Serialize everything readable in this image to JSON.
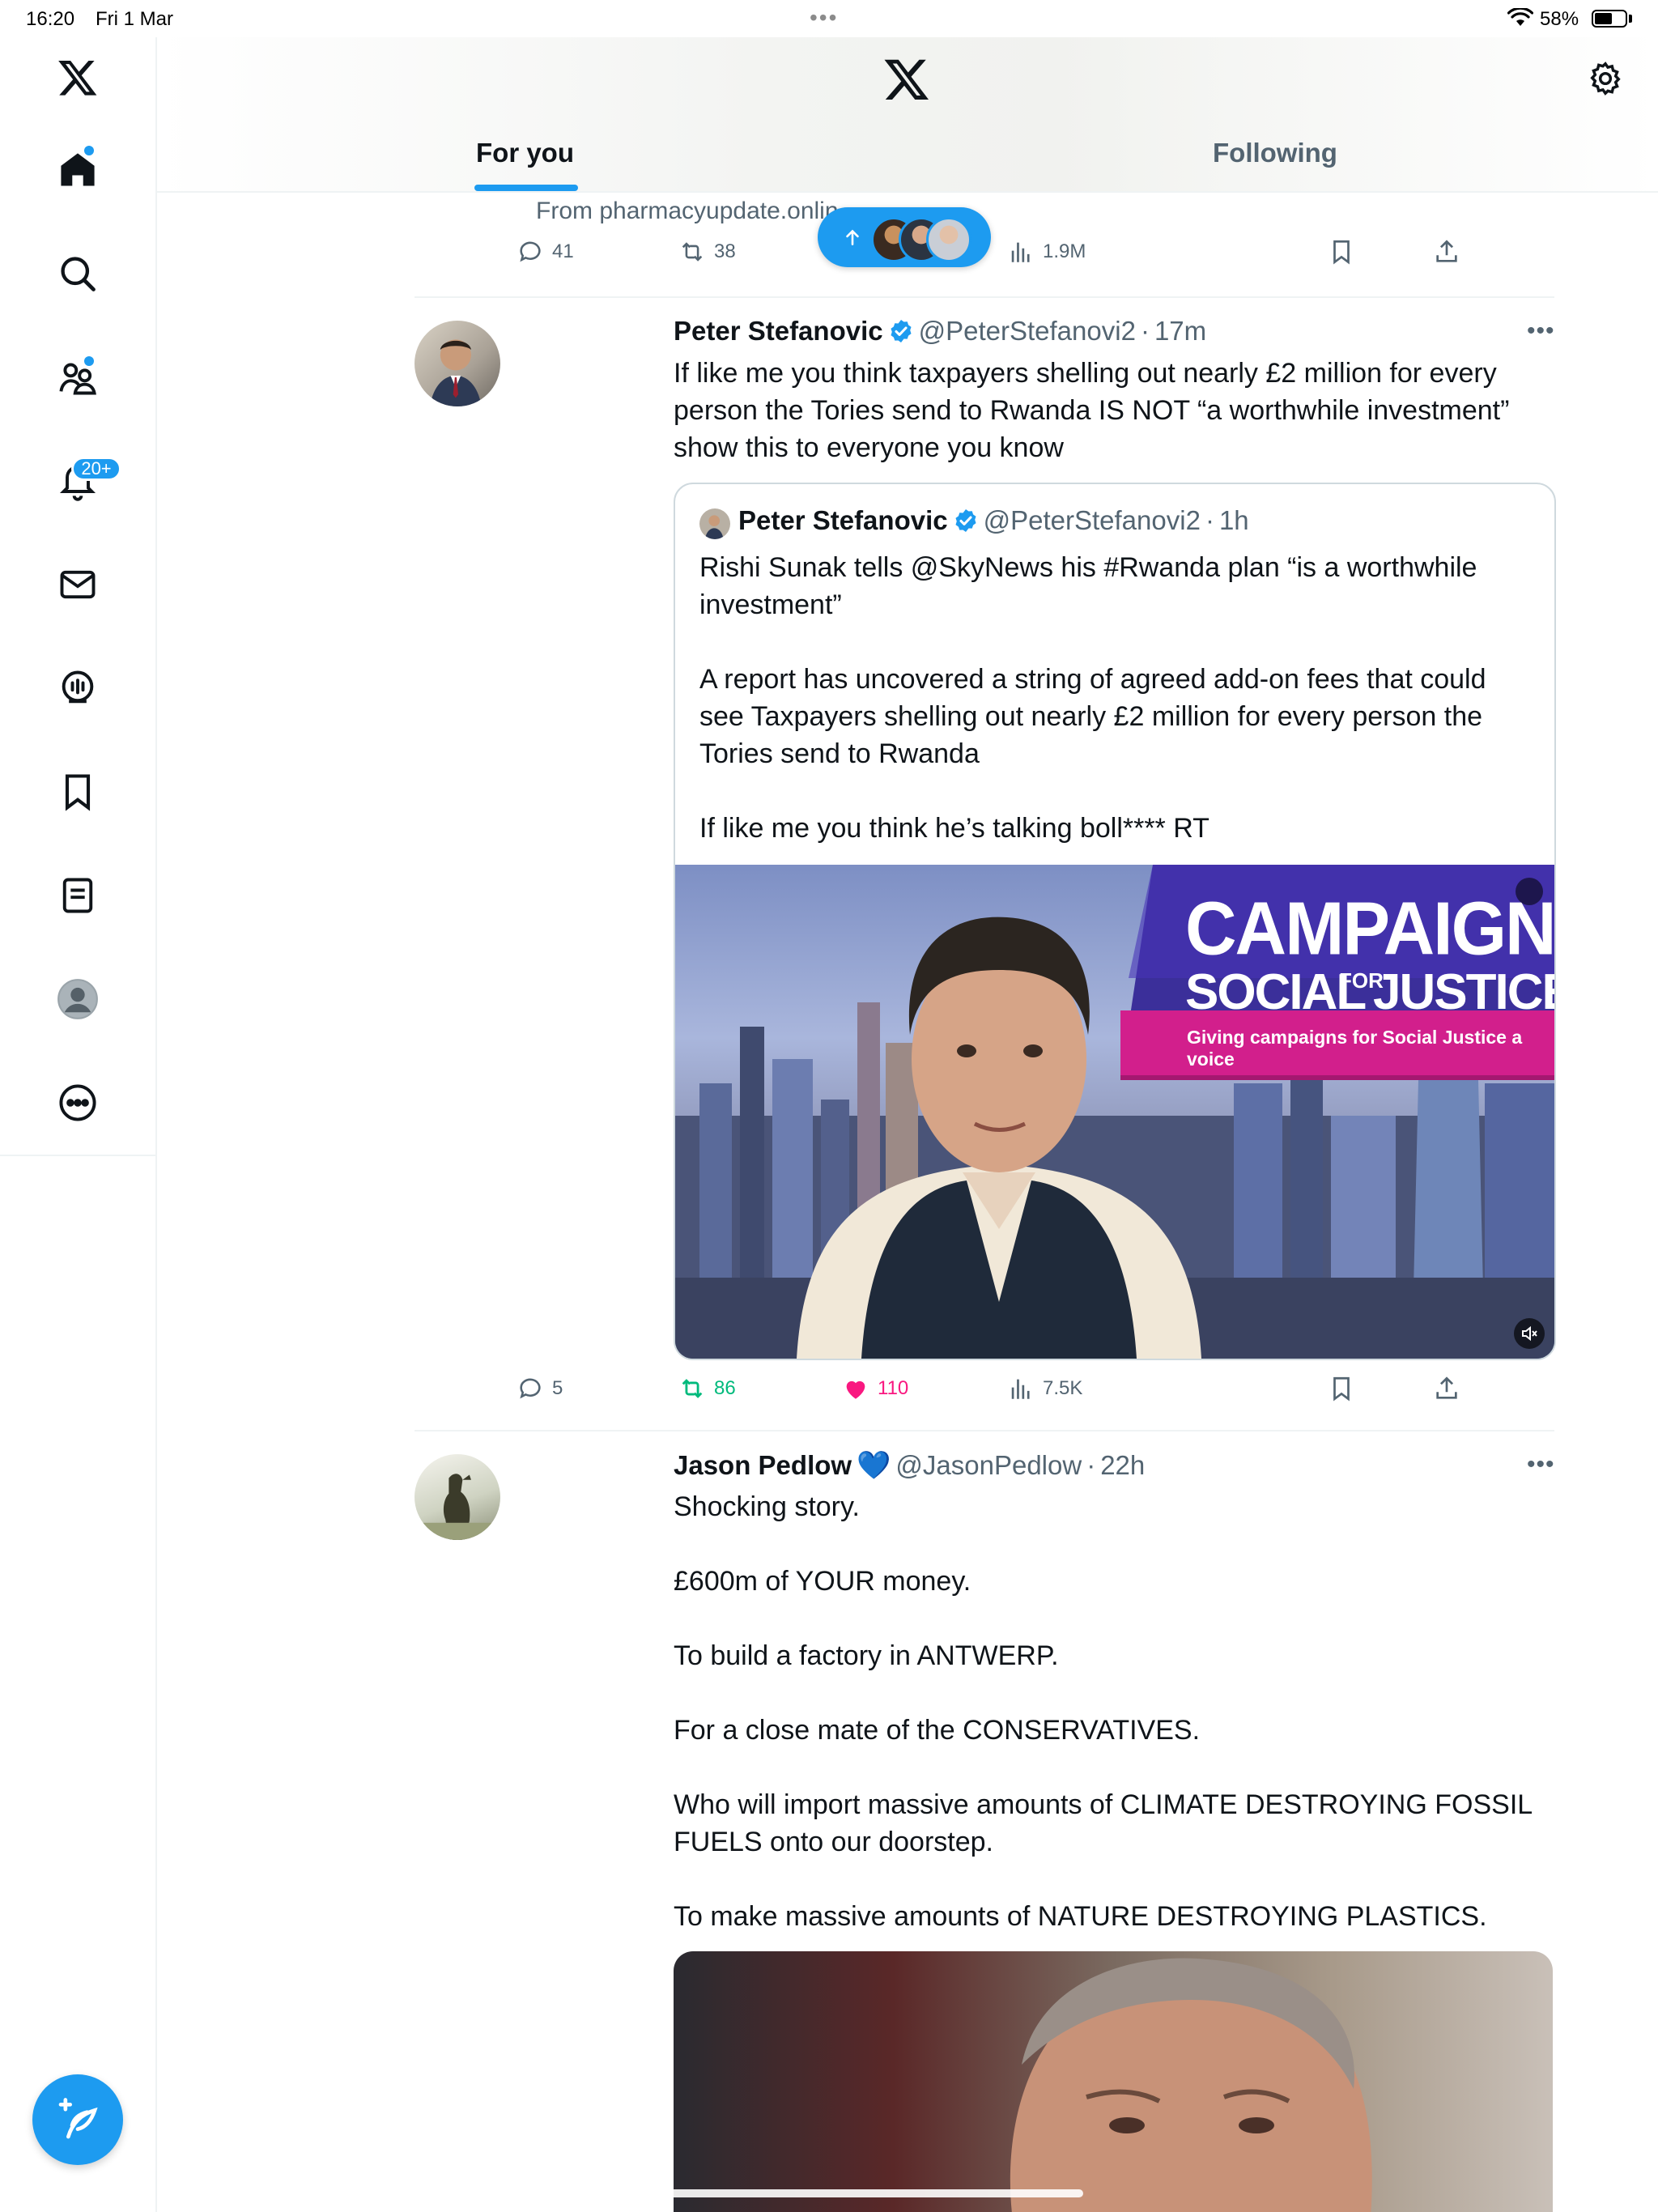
{
  "status_bar": {
    "time": "16:20",
    "date": "Fri 1 Mar",
    "battery_pct": "58%",
    "battery_level": 0.58
  },
  "nav": {
    "notifications_badge": "20+"
  },
  "tabs": {
    "for_you": "For you",
    "following": "Following"
  },
  "posts": [
    {
      "source_text": "From pharmacyupdate.onlin",
      "replies": "41",
      "reposts": "38",
      "views": "1.9M"
    },
    {
      "name": "Peter Stefanovic",
      "handle": "@PeterStefanovi2",
      "dot": "·",
      "time": "17m",
      "text": "If like me you think taxpayers shelling out nearly £2 million for every person the Tories send to Rwanda IS NOT “a worthwhile investment” show this to everyone you know",
      "quote": {
        "name": "Peter Stefanovic",
        "handle": "@PeterStefanovi2",
        "dot": "·",
        "time": "1h",
        "paragraphs": [
          "Rishi Sunak tells @SkyNews his #Rwanda plan “is a worthwhile investment”",
          "A report has uncovered a string of agreed add-on fees that could see Taxpayers shelling out nearly £2 million for every person the Tories send to Rwanda",
          "If like me you think he’s talking boll**** RT"
        ],
        "banner_line1": "CAMPAIGN",
        "banner_line2a": "SOCIAL",
        "banner_line2b": "FOR",
        "banner_line2c": "JUSTICE",
        "banner_tagline": "Giving campaigns for Social Justice a voice"
      },
      "replies": "5",
      "reposts": "86",
      "likes": "110",
      "views": "7.5K"
    },
    {
      "name": "Jason Pedlow",
      "heart": "💙",
      "handle": "@JasonPedlow",
      "dot": "·",
      "time": "22h",
      "paragraphs": [
        "Shocking story.",
        "£600m of YOUR money.",
        "To build a factory in ANTWERP.",
        "For a close mate of the CONSERVATIVES.",
        "Who will import massive amounts of CLIMATE DESTROYING FOSSIL FUELS onto our doorstep.",
        "To make massive amounts of NATURE DESTROYING PLASTICS."
      ]
    }
  ],
  "colors": {
    "accent": "#1d9bf0",
    "repost_green": "#00ba7c",
    "like_pink": "#f91880",
    "muted": "#536471"
  }
}
